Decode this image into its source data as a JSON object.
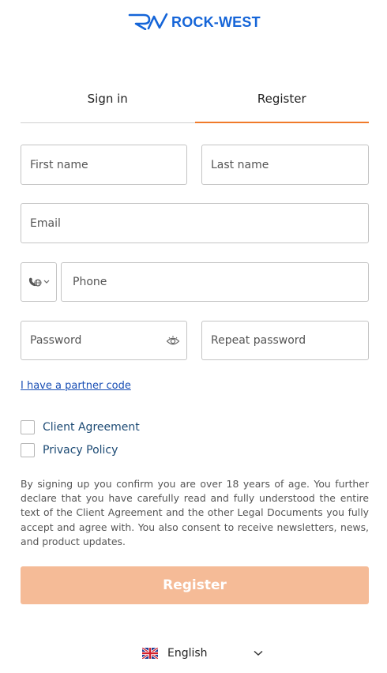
{
  "brand": {
    "name": "ROCK-WEST",
    "color": "#1565d8"
  },
  "tabs": [
    {
      "label": "Sign in",
      "active": false
    },
    {
      "label": "Register",
      "active": true
    }
  ],
  "form": {
    "first_name_placeholder": "First name",
    "last_name_placeholder": "Last name",
    "email_placeholder": "Email",
    "phone_placeholder": "Phone",
    "password_placeholder": "Password",
    "repeat_password_placeholder": "Repeat password",
    "country_icon": "globe-phone-icon"
  },
  "partner_link": "I have a partner code",
  "agreements": [
    {
      "label": "Client Agreement",
      "checked": false
    },
    {
      "label": "Privacy Policy",
      "checked": false
    }
  ],
  "terms_text": "By signing up you confirm you are over 18 years of age. You further declare that you have carefully read and fully understood the entire text of the Client Agreement and the other Legal Documents you fully accept and agree with. You also consent to receive newsletters, news, and product updates.",
  "register_button": "Register",
  "language": {
    "label": "English",
    "flag": "uk-flag-icon"
  },
  "colors": {
    "accent": "#f07a2a",
    "button_disabled": "#f5bb97",
    "link": "#1a4fb5"
  }
}
